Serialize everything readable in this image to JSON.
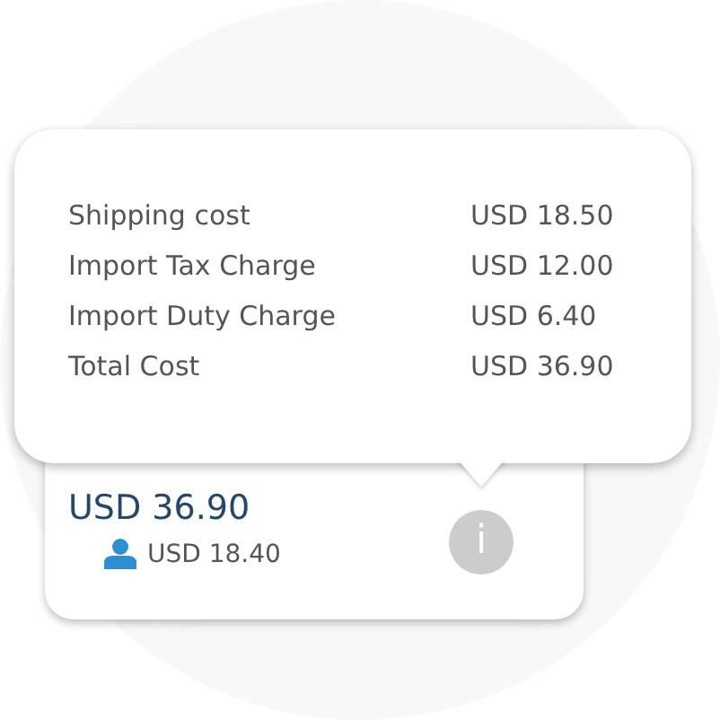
{
  "tooltip": {
    "rows": [
      {
        "label": "Shipping cost",
        "value": "USD 18.50"
      },
      {
        "label": "Import Tax Charge",
        "value": "USD 12.00"
      },
      {
        "label": "Import Duty Charge",
        "value": "USD 6.40"
      },
      {
        "label": "Total Cost",
        "value": "USD 36.90"
      }
    ]
  },
  "card": {
    "price": "USD 36.90",
    "per_person": "USD 18.40",
    "info_glyph": "i"
  }
}
